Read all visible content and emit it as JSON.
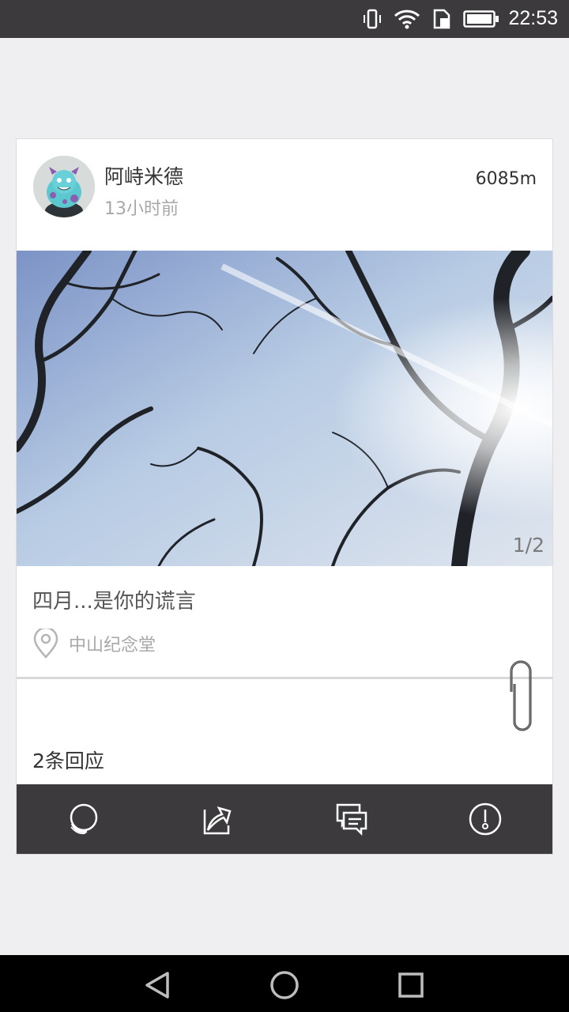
{
  "status_bar": {
    "time": "22:53",
    "icons": [
      "vibrate-icon",
      "wifi-icon",
      "sim-icon",
      "battery-icon"
    ]
  },
  "post": {
    "username": "阿峙米德",
    "time_ago": "13小时前",
    "distance": "6085m",
    "image_counter": "1/2",
    "caption": "四月...是你的谎言",
    "location": "中山纪念堂",
    "replies": "2条回应"
  },
  "actions": [
    "like-icon",
    "share-icon",
    "comment-icon",
    "report-icon"
  ],
  "nav_bar": [
    "back-icon",
    "home-icon",
    "recents-icon"
  ],
  "colors": {
    "bar": "#3c3a3d",
    "background": "#efeff1"
  }
}
